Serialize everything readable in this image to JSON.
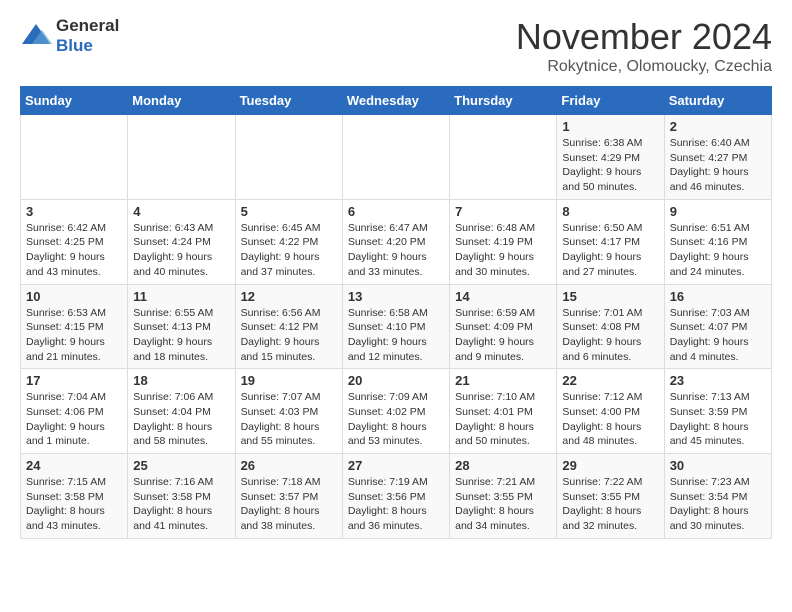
{
  "header": {
    "logo_general": "General",
    "logo_blue": "Blue",
    "month_title": "November 2024",
    "location": "Rokytnice, Olomoucky, Czechia"
  },
  "columns": [
    "Sunday",
    "Monday",
    "Tuesday",
    "Wednesday",
    "Thursday",
    "Friday",
    "Saturday"
  ],
  "weeks": [
    [
      {
        "day": "",
        "info": ""
      },
      {
        "day": "",
        "info": ""
      },
      {
        "day": "",
        "info": ""
      },
      {
        "day": "",
        "info": ""
      },
      {
        "day": "",
        "info": ""
      },
      {
        "day": "1",
        "info": "Sunrise: 6:38 AM\nSunset: 4:29 PM\nDaylight: 9 hours and 50 minutes."
      },
      {
        "day": "2",
        "info": "Sunrise: 6:40 AM\nSunset: 4:27 PM\nDaylight: 9 hours and 46 minutes."
      }
    ],
    [
      {
        "day": "3",
        "info": "Sunrise: 6:42 AM\nSunset: 4:25 PM\nDaylight: 9 hours and 43 minutes."
      },
      {
        "day": "4",
        "info": "Sunrise: 6:43 AM\nSunset: 4:24 PM\nDaylight: 9 hours and 40 minutes."
      },
      {
        "day": "5",
        "info": "Sunrise: 6:45 AM\nSunset: 4:22 PM\nDaylight: 9 hours and 37 minutes."
      },
      {
        "day": "6",
        "info": "Sunrise: 6:47 AM\nSunset: 4:20 PM\nDaylight: 9 hours and 33 minutes."
      },
      {
        "day": "7",
        "info": "Sunrise: 6:48 AM\nSunset: 4:19 PM\nDaylight: 9 hours and 30 minutes."
      },
      {
        "day": "8",
        "info": "Sunrise: 6:50 AM\nSunset: 4:17 PM\nDaylight: 9 hours and 27 minutes."
      },
      {
        "day": "9",
        "info": "Sunrise: 6:51 AM\nSunset: 4:16 PM\nDaylight: 9 hours and 24 minutes."
      }
    ],
    [
      {
        "day": "10",
        "info": "Sunrise: 6:53 AM\nSunset: 4:15 PM\nDaylight: 9 hours and 21 minutes."
      },
      {
        "day": "11",
        "info": "Sunrise: 6:55 AM\nSunset: 4:13 PM\nDaylight: 9 hours and 18 minutes."
      },
      {
        "day": "12",
        "info": "Sunrise: 6:56 AM\nSunset: 4:12 PM\nDaylight: 9 hours and 15 minutes."
      },
      {
        "day": "13",
        "info": "Sunrise: 6:58 AM\nSunset: 4:10 PM\nDaylight: 9 hours and 12 minutes."
      },
      {
        "day": "14",
        "info": "Sunrise: 6:59 AM\nSunset: 4:09 PM\nDaylight: 9 hours and 9 minutes."
      },
      {
        "day": "15",
        "info": "Sunrise: 7:01 AM\nSunset: 4:08 PM\nDaylight: 9 hours and 6 minutes."
      },
      {
        "day": "16",
        "info": "Sunrise: 7:03 AM\nSunset: 4:07 PM\nDaylight: 9 hours and 4 minutes."
      }
    ],
    [
      {
        "day": "17",
        "info": "Sunrise: 7:04 AM\nSunset: 4:06 PM\nDaylight: 9 hours and 1 minute."
      },
      {
        "day": "18",
        "info": "Sunrise: 7:06 AM\nSunset: 4:04 PM\nDaylight: 8 hours and 58 minutes."
      },
      {
        "day": "19",
        "info": "Sunrise: 7:07 AM\nSunset: 4:03 PM\nDaylight: 8 hours and 55 minutes."
      },
      {
        "day": "20",
        "info": "Sunrise: 7:09 AM\nSunset: 4:02 PM\nDaylight: 8 hours and 53 minutes."
      },
      {
        "day": "21",
        "info": "Sunrise: 7:10 AM\nSunset: 4:01 PM\nDaylight: 8 hours and 50 minutes."
      },
      {
        "day": "22",
        "info": "Sunrise: 7:12 AM\nSunset: 4:00 PM\nDaylight: 8 hours and 48 minutes."
      },
      {
        "day": "23",
        "info": "Sunrise: 7:13 AM\nSunset: 3:59 PM\nDaylight: 8 hours and 45 minutes."
      }
    ],
    [
      {
        "day": "24",
        "info": "Sunrise: 7:15 AM\nSunset: 3:58 PM\nDaylight: 8 hours and 43 minutes."
      },
      {
        "day": "25",
        "info": "Sunrise: 7:16 AM\nSunset: 3:58 PM\nDaylight: 8 hours and 41 minutes."
      },
      {
        "day": "26",
        "info": "Sunrise: 7:18 AM\nSunset: 3:57 PM\nDaylight: 8 hours and 38 minutes."
      },
      {
        "day": "27",
        "info": "Sunrise: 7:19 AM\nSunset: 3:56 PM\nDaylight: 8 hours and 36 minutes."
      },
      {
        "day": "28",
        "info": "Sunrise: 7:21 AM\nSunset: 3:55 PM\nDaylight: 8 hours and 34 minutes."
      },
      {
        "day": "29",
        "info": "Sunrise: 7:22 AM\nSunset: 3:55 PM\nDaylight: 8 hours and 32 minutes."
      },
      {
        "day": "30",
        "info": "Sunrise: 7:23 AM\nSunset: 3:54 PM\nDaylight: 8 hours and 30 minutes."
      }
    ]
  ]
}
